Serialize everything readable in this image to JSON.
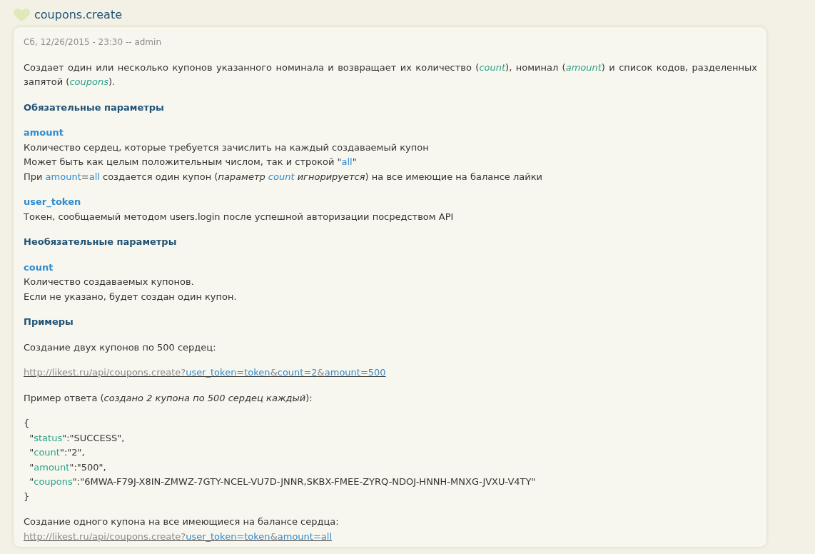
{
  "title": "coupons.create",
  "blocks": [
    {
      "kind": "meta",
      "text": "Сб, 12/26/2015 - 23:30 -- admin"
    },
    {
      "kind": "para",
      "lines": [
        {
          "kind": "justified",
          "segments": [
            {
              "kind": "t",
              "text": "Создает один или несколько купонов указанного номинала и возвращает их количество ("
            },
            {
              "kind": "ref",
              "text": "count"
            },
            {
              "kind": "t",
              "text": "), номинал ("
            },
            {
              "kind": "ref",
              "text": "amount"
            },
            {
              "kind": "t",
              "text": ") и список кодов, разделенных запятой ("
            },
            {
              "kind": "ref",
              "text": "coupons"
            },
            {
              "kind": "t",
              "text": ")."
            }
          ]
        }
      ]
    },
    {
      "kind": "heading",
      "text": "Обязательные параметры"
    },
    {
      "kind": "param",
      "name": "amount",
      "lines": [
        [
          {
            "kind": "t",
            "text": "Количество сердец, которые требуется зачислить на каждый создаваемый купон"
          }
        ],
        [
          {
            "kind": "t",
            "text": "Может быть как целым положительным числом, так и строкой \""
          },
          {
            "kind": "param",
            "text": "all"
          },
          {
            "kind": "t",
            "text": "\""
          }
        ],
        [
          {
            "kind": "t",
            "text": "При "
          },
          {
            "kind": "param",
            "text": "amount"
          },
          {
            "kind": "t",
            "text": "="
          },
          {
            "kind": "param",
            "text": "all"
          },
          {
            "kind": "t",
            "text": " создается один купон ("
          },
          {
            "kind": "em",
            "text": "параметр "
          },
          {
            "kind": "em_param",
            "text": "count"
          },
          {
            "kind": "em",
            "text": " игнорируется"
          },
          {
            "kind": "t",
            "text": ") на все имеющие на балансе лайки"
          }
        ]
      ]
    },
    {
      "kind": "param",
      "name": "user_token",
      "lines": [
        [
          {
            "kind": "t",
            "text": "Токен, сообщаемый методом users.login после успешной авторизации посредством API"
          }
        ]
      ]
    },
    {
      "kind": "heading",
      "text": "Необязательные параметры"
    },
    {
      "kind": "param",
      "name": "count",
      "lines": [
        [
          {
            "kind": "t",
            "text": "Количество создаваемых купонов."
          }
        ],
        [
          {
            "kind": "t",
            "text": "Если не указано, будет создан один купон."
          }
        ]
      ]
    },
    {
      "kind": "heading",
      "text": "Примеры"
    },
    {
      "kind": "para",
      "lines": [
        {
          "kind": "text",
          "segments": [
            {
              "kind": "t",
              "text": "Создание двух купонов по 500 сердец:"
            }
          ]
        }
      ]
    },
    {
      "kind": "para",
      "lines": [
        {
          "kind": "link",
          "segments": [
            {
              "kind": "base",
              "text": "http://likest.ru/api/coupons.create?"
            },
            {
              "kind": "param",
              "text": "user_token=token"
            },
            {
              "kind": "base",
              "text": "&"
            },
            {
              "kind": "param",
              "text": "count=2"
            },
            {
              "kind": "base",
              "text": "&"
            },
            {
              "kind": "param",
              "text": "amount=500"
            }
          ]
        }
      ]
    },
    {
      "kind": "para",
      "lines": [
        {
          "kind": "text",
          "segments": [
            {
              "kind": "t",
              "text": "Пример ответа ("
            },
            {
              "kind": "em",
              "text": "создано 2 купона по 500 сердец каждый"
            },
            {
              "kind": "t",
              "text": "):"
            }
          ]
        }
      ]
    },
    {
      "kind": "code",
      "lines": [
        [
          {
            "kind": "t",
            "text": "{"
          }
        ],
        [
          {
            "kind": "t",
            "text": "  \""
          },
          {
            "kind": "key",
            "text": "status"
          },
          {
            "kind": "t",
            "text": "\":\"SUCCESS\","
          }
        ],
        [
          {
            "kind": "t",
            "text": "  \""
          },
          {
            "kind": "key",
            "text": "count"
          },
          {
            "kind": "t",
            "text": "\":\"2\","
          }
        ],
        [
          {
            "kind": "t",
            "text": "  \""
          },
          {
            "kind": "key",
            "text": "amount"
          },
          {
            "kind": "t",
            "text": "\":\"500\","
          }
        ],
        [
          {
            "kind": "t",
            "text": "  \""
          },
          {
            "kind": "key",
            "text": "coupons"
          },
          {
            "kind": "t",
            "text": "\":\"6MWA-F79J-X8IN-ZMWZ-7GTY-NCEL-VU7D-JNNR,SKBX-FMEE-ZYRQ-NDOJ-HNNH-MNXG-JVXU-V4TY\""
          }
        ],
        [
          {
            "kind": "t",
            "text": "}"
          }
        ]
      ]
    },
    {
      "kind": "para",
      "lines": [
        {
          "kind": "text",
          "segments": [
            {
              "kind": "t",
              "text": "Создание одного купона на все имеющиеся на балансе сердца:"
            }
          ]
        },
        {
          "kind": "link",
          "segments": [
            {
              "kind": "base",
              "text": "http://likest.ru/api/coupons.create?"
            },
            {
              "kind": "param",
              "text": "user_token=token"
            },
            {
              "kind": "base",
              "text": "&"
            },
            {
              "kind": "param",
              "text": "amount=all"
            }
          ]
        }
      ]
    }
  ]
}
